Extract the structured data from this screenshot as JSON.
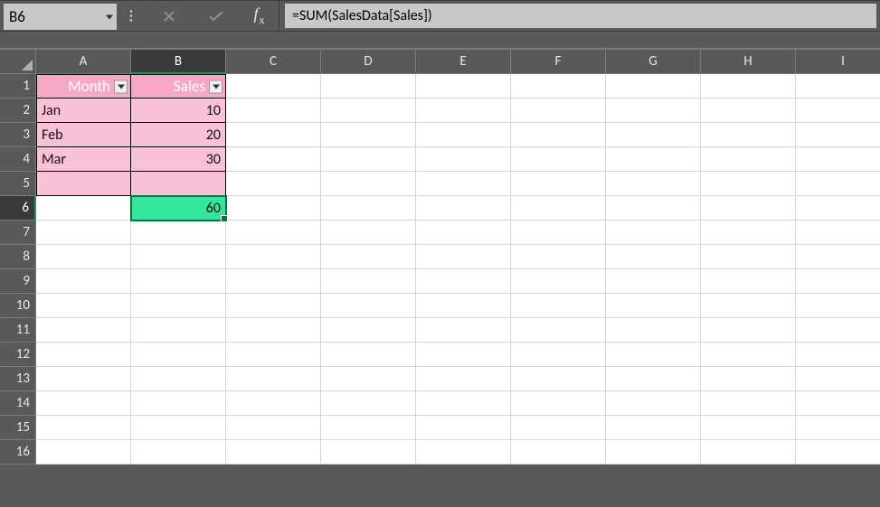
{
  "nameBox": {
    "value": "B6"
  },
  "formulaBar": {
    "cancelIcon": "cancel-icon",
    "acceptIcon": "accept-icon",
    "fxLabel": "fx",
    "formula": "=SUM(SalesData[Sales])"
  },
  "columns": [
    "A",
    "B",
    "C",
    "D",
    "E",
    "F",
    "G",
    "H",
    "I"
  ],
  "rows": [
    "1",
    "2",
    "3",
    "4",
    "5",
    "6",
    "7",
    "8",
    "9",
    "10",
    "11",
    "12",
    "13",
    "14",
    "15",
    "16"
  ],
  "activeColumn": "B",
  "activeRow": "6",
  "table": {
    "headers": {
      "A": "Month",
      "B": "Sales"
    },
    "data": [
      {
        "A": "Jan",
        "B": "10"
      },
      {
        "A": "Feb",
        "B": "20"
      },
      {
        "A": "Mar",
        "B": "30"
      },
      {
        "A": "",
        "B": ""
      }
    ]
  },
  "resultCell": {
    "ref": "B6",
    "value": "60"
  }
}
